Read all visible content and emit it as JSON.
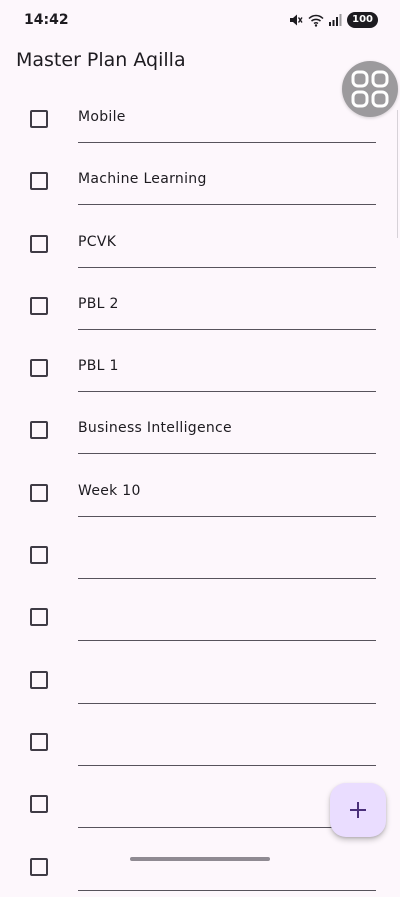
{
  "status_bar": {
    "time": "14:42",
    "battery": "100",
    "icons": [
      "mute-icon",
      "wifi-icon",
      "signal-icon"
    ]
  },
  "app": {
    "title": "Master Plan Aqilla"
  },
  "tasks": [
    {
      "description": "Mobile",
      "complete": false
    },
    {
      "description": "Machine Learning",
      "complete": false
    },
    {
      "description": "PCVK",
      "complete": false
    },
    {
      "description": "PBL 2",
      "complete": false
    },
    {
      "description": "PBL 1",
      "complete": false
    },
    {
      "description": "Business Intelligence",
      "complete": false
    },
    {
      "description": "Week 10",
      "complete": false
    },
    {
      "description": "",
      "complete": false
    },
    {
      "description": "",
      "complete": false
    },
    {
      "description": "",
      "complete": false
    },
    {
      "description": "",
      "complete": false
    },
    {
      "description": "",
      "complete": false
    },
    {
      "description": "",
      "complete": false
    }
  ],
  "fab": {
    "icon": "add-icon"
  },
  "colors": {
    "background": "#fdf7fc",
    "fab": "#eaddff",
    "accent": "#4a2f7a"
  }
}
